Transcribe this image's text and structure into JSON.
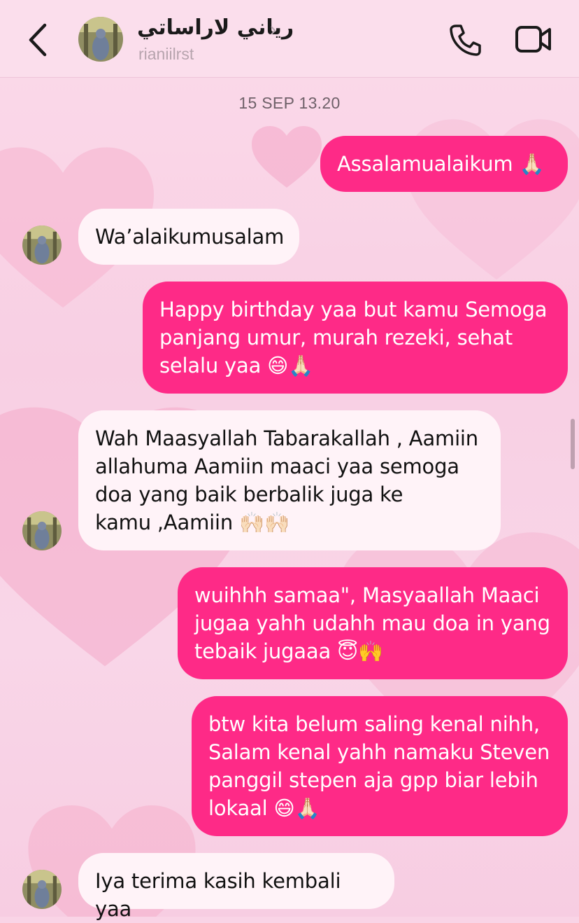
{
  "header": {
    "back_icon": "chevron-left-icon",
    "name": "رياني لاراساتي",
    "chevron": "›",
    "username": "rianiilrst",
    "call_icon": "phone-icon",
    "video_icon": "video-camera-icon"
  },
  "chat": {
    "date": "15 SEP 13.20",
    "messages": [
      {
        "from": "me",
        "text": "Assalamualaikum 🙏🏻"
      },
      {
        "from": "them",
        "text": "Wa’alaikumusalam"
      },
      {
        "from": "me",
        "text": "Happy birthday yaa but kamu Semoga\npanjang umur, murah rezeki, sehat\nselalu yaa 😄🙏🏻"
      },
      {
        "from": "them",
        "text": "Wah Maasyallah Tabarakallah , Aamiin\nallahuma Aamiin maaci yaa semoga\ndoa yang baik berbalik juga ke\nkamu ,Aamiin 🙌🏻🙌🏻"
      },
      {
        "from": "me",
        "text": "wuihhh samaa\",  Masyaallah Maaci\njugaa yahh udahh mau doa in yang\ntebaik jugaaa 😇🙌"
      },
      {
        "from": "me",
        "text": "btw kita belum saling kenal nihh,\nSalam kenal yahh namaku Steven\npanggil stepen aja gpp biar lebih\nlokaal 😄🙏🏻"
      },
      {
        "from": "them",
        "text": "Iya terima kasih kembali yaa"
      }
    ]
  },
  "colors": {
    "outgoing": "#fe2a87",
    "incoming": "#fff3f8",
    "background": "#f9d4e6"
  }
}
